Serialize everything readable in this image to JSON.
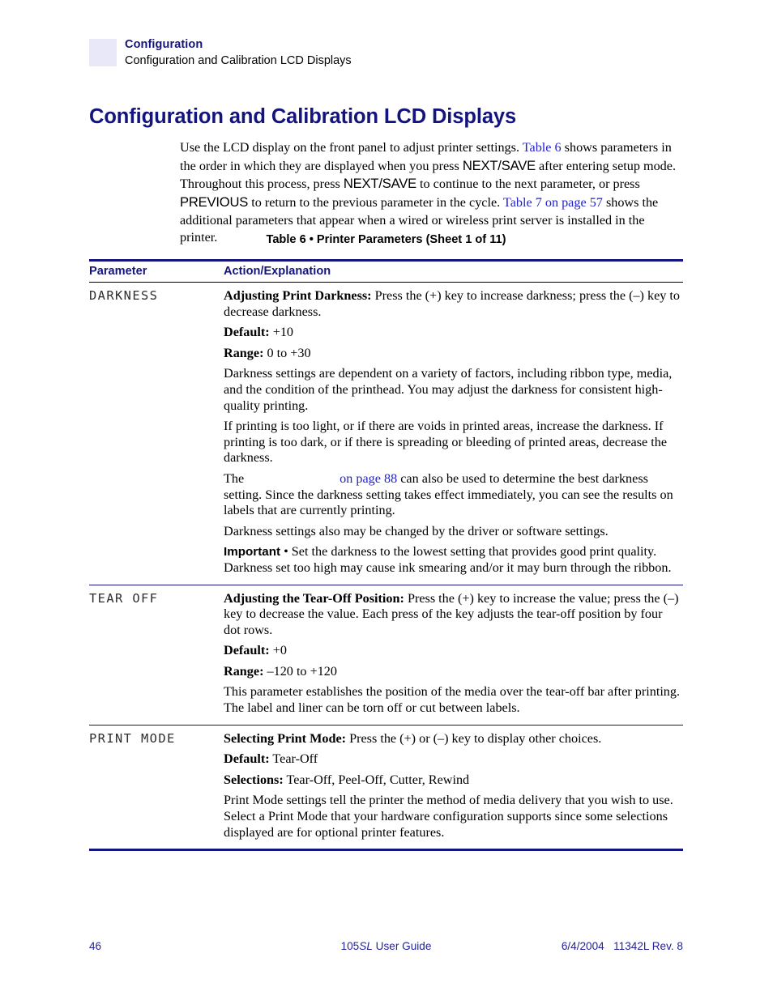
{
  "header": {
    "title": "Configuration",
    "subtitle": "Configuration and Calibration LCD Displays"
  },
  "page_heading": "Configuration and Calibration LCD Displays",
  "intro": {
    "s1": "Use the LCD display on the front panel to adjust printer settings. ",
    "link1": "Table 6",
    "s2": " shows parameters in the order in which they are displayed when you press ",
    "btn1": "NEXT/SAVE",
    "s3": " after entering setup mode. Throughout this process, press ",
    "btn2": "NEXT/SAVE",
    "s4": " to continue to the next parameter, or press ",
    "btn3": "PREVIOUS",
    "s5": " to return to the previous parameter in the cycle. ",
    "link2": "Table 7 on page 57",
    "s6": " shows the additional parameters that appear when a wired or wireless print server is installed in the printer."
  },
  "table": {
    "caption": "Table 6 • Printer Parameters (Sheet 1 of 11)",
    "headers": {
      "parameter": "Parameter",
      "action": "Action/Explanation"
    },
    "rows": [
      {
        "parameter": "DARKNESS",
        "blocks": {
          "b1_label": "Adjusting Print Darkness:",
          "b1_text": " Press the (+) key to increase darkness; press the (–) key to decrease darkness.",
          "b2_label": "Default:",
          "b2_text": " +10",
          "b3_label": "Range:",
          "b3_text": " 0 to +30",
          "b4_text": "Darkness settings are dependent on a variety of factors, including ribbon type, media, and the condition of the printhead. You may adjust the darkness for consistent high-quality printing.",
          "b5_text": "If printing is too light, or if there are voids in printed areas, increase the darkness. If printing is too dark, or if there is spreading or bleeding of printed areas, decrease the darkness.",
          "b6_pre": "The",
          "b6_link": "on page 88",
          "b6_post": " can also be used to determine the best darkness setting. Since the darkness setting takes effect immediately, you can see the results on labels that are currently printing.",
          "b7_text": "Darkness settings also may be changed by the driver or software settings.",
          "b8_label": "Important",
          "b8_text": " • Set the darkness to the lowest setting that provides good print quality. Darkness set too high may cause ink smearing and/or it may burn through the ribbon."
        }
      },
      {
        "parameter": "TEAR OFF",
        "blocks": {
          "b1_label": "Adjusting the Tear-Off Position:",
          "b1_text": " Press the (+) key to increase the value; press the (–) key to decrease the value. Each press of the key adjusts the tear-off position by four dot rows.",
          "b2_label": "Default:",
          "b2_text": " +0",
          "b3_label": "Range:",
          "b3_text": " –120 to +120",
          "b4_text": "This parameter establishes the position of the media over the tear-off bar after printing. The label and liner can be torn off or cut between labels."
        }
      },
      {
        "parameter": "PRINT MODE",
        "blocks": {
          "b1_label": "Selecting Print Mode:",
          "b1_text": " Press the (+) or (–) key to display other choices.",
          "b2_label": "Default:",
          "b2_text": " Tear-Off",
          "b3_label": "Selections:",
          "b3_text": " Tear-Off, Peel-Off, Cutter, Rewind",
          "b4_text": "Print Mode settings tell the printer the method of media delivery that you wish to use. Select a Print Mode that your hardware configuration supports since some selections displayed are for optional printer features."
        }
      }
    ]
  },
  "footer": {
    "page_number": "46",
    "guide_pre": "105",
    "guide_italic": "SL",
    "guide_post": " User Guide",
    "date": "6/4/2004",
    "revision": "11342L Rev. 8"
  },
  "colors": {
    "navy": "#14147d",
    "link": "#2323c8",
    "header_swatch": "#e8e8f8",
    "footer_text": "#24249a"
  }
}
